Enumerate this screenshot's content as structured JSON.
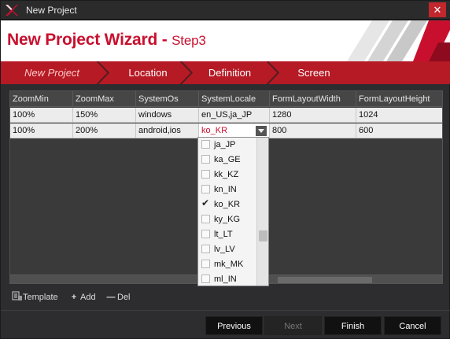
{
  "window": {
    "title": "New Project",
    "close_glyph": "✕"
  },
  "header": {
    "title": "New Project Wizard - ",
    "step": "Step3"
  },
  "steps": [
    {
      "label": "New Project",
      "active": true
    },
    {
      "label": "Location",
      "active": false
    },
    {
      "label": "Definition",
      "active": false
    },
    {
      "label": "Screen",
      "active": false
    }
  ],
  "grid": {
    "columns": [
      "ZoomMin",
      "ZoomMax",
      "SystemOs",
      "SystemLocale",
      "FormLayoutWidth",
      "FormLayoutHeight"
    ],
    "rows": [
      [
        "100%",
        "150%",
        "windows",
        "en_US,ja_JP",
        "1280",
        "1024"
      ],
      [
        "100%",
        "200%",
        "android,ios",
        "ko_KR",
        "800",
        "600"
      ]
    ]
  },
  "locale_dropdown": {
    "items": [
      {
        "label": "ja_JP",
        "checked": false
      },
      {
        "label": "ka_GE",
        "checked": false
      },
      {
        "label": "kk_KZ",
        "checked": false
      },
      {
        "label": "kn_IN",
        "checked": false
      },
      {
        "label": "ko_KR",
        "checked": true
      },
      {
        "label": "ky_KG",
        "checked": false
      },
      {
        "label": "lt_LT",
        "checked": false
      },
      {
        "label": "lv_LV",
        "checked": false
      },
      {
        "label": "mk_MK",
        "checked": false
      },
      {
        "label": "ml_IN",
        "checked": false
      }
    ]
  },
  "toolbar": {
    "template_label": "Template",
    "add_label": "Add",
    "del_label": "Del"
  },
  "buttons": {
    "previous": "Previous",
    "next": "Next",
    "finish": "Finish",
    "cancel": "Cancel"
  },
  "colors": {
    "accent": "#c8102e",
    "step_bar": "#b51a25"
  }
}
